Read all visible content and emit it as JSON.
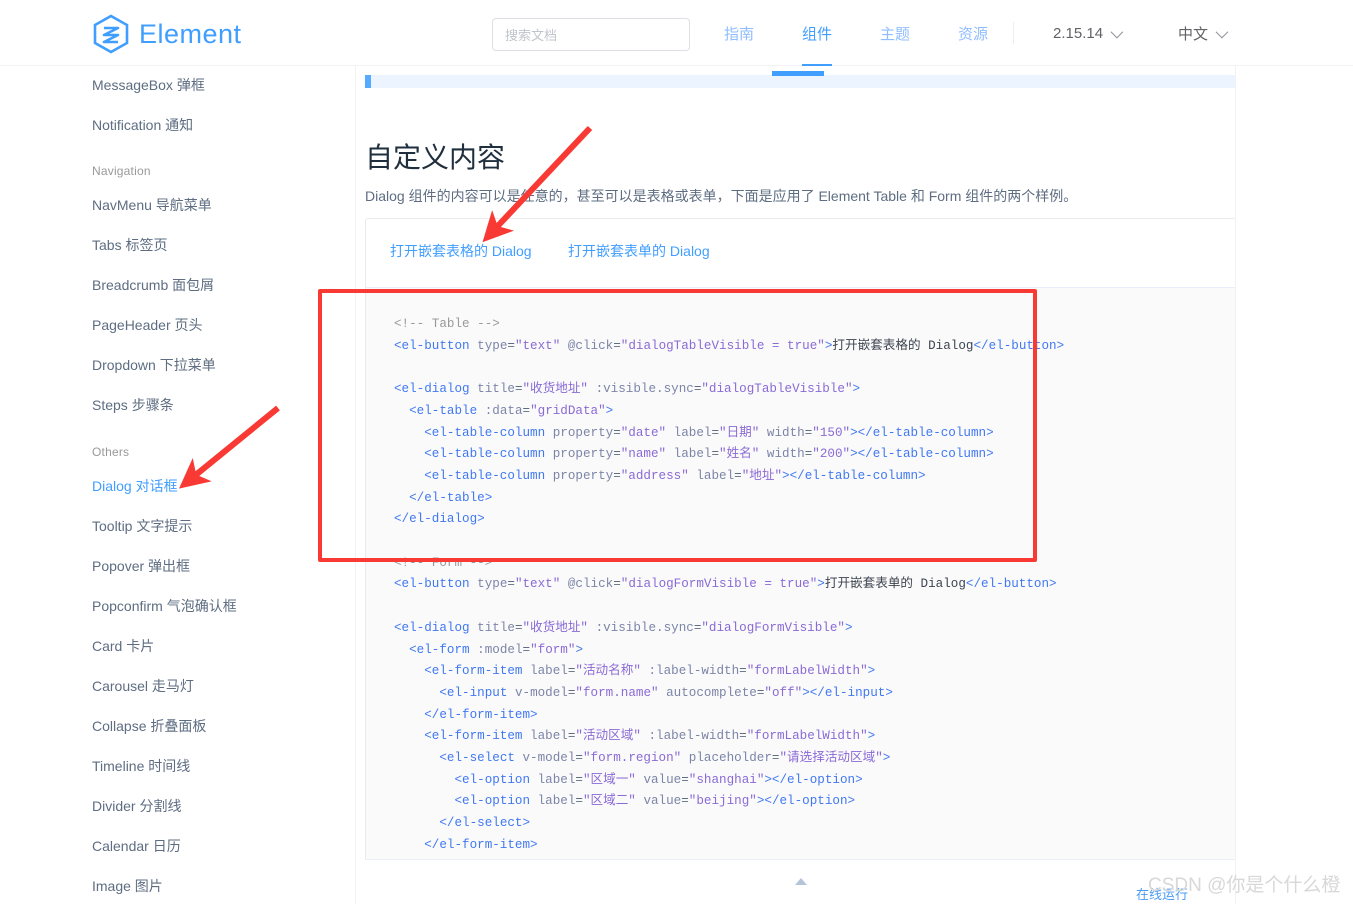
{
  "header": {
    "logo_text": "Element",
    "logo_icon": "element-hexagon-logo",
    "search": {
      "placeholder": "搜索文档",
      "icon": "search-icon"
    },
    "nav": [
      {
        "label": "指南",
        "active": false
      },
      {
        "label": "组件",
        "active": true
      },
      {
        "label": "主题",
        "active": false
      },
      {
        "label": "资源",
        "active": false
      }
    ],
    "version": {
      "label": "2.15.14",
      "icon": "chevron-down-icon"
    },
    "language": {
      "label": "中文",
      "icon": "chevron-down-icon"
    }
  },
  "sidebar": {
    "items": [
      {
        "label": "MessageBox 弹框",
        "type": "link",
        "active": false
      },
      {
        "label": "Notification 通知",
        "type": "link",
        "active": false
      },
      {
        "label": "Navigation",
        "type": "group"
      },
      {
        "label": "NavMenu 导航菜单",
        "type": "link",
        "active": false
      },
      {
        "label": "Tabs 标签页",
        "type": "link",
        "active": false
      },
      {
        "label": "Breadcrumb 面包屑",
        "type": "link",
        "active": false
      },
      {
        "label": "PageHeader 页头",
        "type": "link",
        "active": false
      },
      {
        "label": "Dropdown 下拉菜单",
        "type": "link",
        "active": false
      },
      {
        "label": "Steps 步骤条",
        "type": "link",
        "active": false
      },
      {
        "label": "Others",
        "type": "group"
      },
      {
        "label": "Dialog 对话框",
        "type": "link",
        "active": true
      },
      {
        "label": "Tooltip 文字提示",
        "type": "link",
        "active": false
      },
      {
        "label": "Popover 弹出框",
        "type": "link",
        "active": false
      },
      {
        "label": "Popconfirm 气泡确认框",
        "type": "link",
        "active": false
      },
      {
        "label": "Card 卡片",
        "type": "link",
        "active": false
      },
      {
        "label": "Carousel 走马灯",
        "type": "link",
        "active": false
      },
      {
        "label": "Collapse 折叠面板",
        "type": "link",
        "active": false
      },
      {
        "label": "Timeline 时间线",
        "type": "link",
        "active": false
      },
      {
        "label": "Divider 分割线",
        "type": "link",
        "active": false
      },
      {
        "label": "Calendar 日历",
        "type": "link",
        "active": false
      },
      {
        "label": "Image 图片",
        "type": "link",
        "active": false
      }
    ]
  },
  "main": {
    "heading": "自定义内容",
    "paragraph": "Dialog 组件的内容可以是任意的，甚至可以是表格或表单，下面是应用了 Element Table 和 Form 组件的两个样例。",
    "demo_links": [
      "打开嵌套表格的 Dialog",
      "打开嵌套表单的 Dialog"
    ],
    "code_table": [
      {
        "t": "c",
        "v": "<!-- Table -->"
      },
      {
        "t": "nl"
      },
      {
        "t": "line_button_table"
      },
      {
        "t": "nl"
      },
      {
        "t": "nl"
      },
      {
        "t": "line_dialog_table"
      }
    ],
    "code_raw_table": "<!-- Table -->\n<el-button type=\"text\" @click=\"dialogTableVisible = true\">打开嵌套表格的 Dialog</el-button>\n\n<el-dialog title=\"收货地址\" :visible.sync=\"dialogTableVisible\">\n  <el-table :data=\"gridData\">\n    <el-table-column property=\"date\" label=\"日期\" width=\"150\"></el-table-column>\n    <el-table-column property=\"name\" label=\"姓名\" width=\"200\"></el-table-column>\n    <el-table-column property=\"address\" label=\"地址\"></el-table-column>\n  </el-table>\n</el-dialog>",
    "code_raw_form": "<!-- Form -->\n<el-button type=\"text\" @click=\"dialogFormVisible = true\">打开嵌套表单的 Dialog</el-button>\n\n<el-dialog title=\"收货地址\" :visible.sync=\"dialogFormVisible\">\n  <el-form :model=\"form\">\n    <el-form-item label=\"活动名称\" :label-width=\"formLabelWidth\">\n      <el-input v-model=\"form.name\" autocomplete=\"off\"></el-input>\n    </el-form-item>\n    <el-form-item label=\"活动区域\" :label-width=\"formLabelWidth\">\n      <el-select v-model=\"form.region\" placeholder=\"请选择活动区域\">\n        <el-option label=\"区域一\" value=\"shanghai\"></el-option>\n        <el-option label=\"区域二\" value=\"beijing\"></el-option>\n      </el-select>\n    </el-form-item>",
    "collapse_icon": "triangle-up-icon"
  },
  "footer": {
    "run_link": "在线运行",
    "watermark": "CSDN @你是个什么橙"
  },
  "annotations": {
    "rect_color": "#f93a34",
    "arrow_color": "#f93a34",
    "arrow_count": 2
  },
  "colors": {
    "brand": "#409eff",
    "text": "#5e6d82",
    "heading": "#1f2f3d",
    "code_bg": "#fafafa",
    "annotation_red": "#f93a34"
  }
}
